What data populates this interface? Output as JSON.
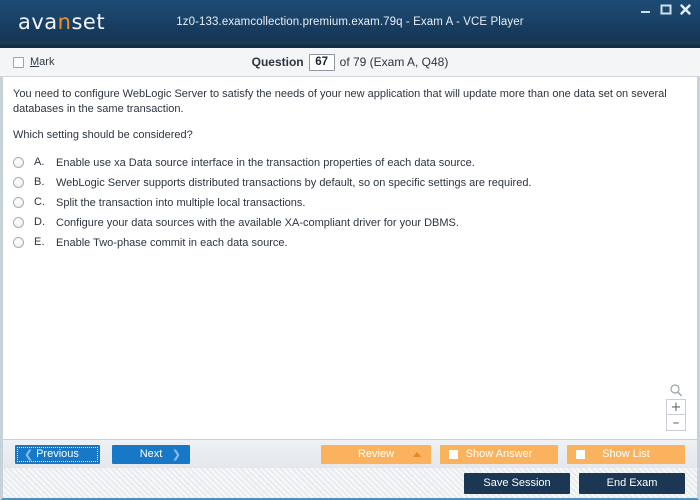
{
  "window": {
    "logo_main": "ava",
    "logo_highlight": "n",
    "logo_tail": "set",
    "title": "1z0-133.examcollection.premium.exam.79q - Exam A - VCE Player",
    "controls": {
      "minimize": "minimize-icon",
      "maximize": "maximize-icon",
      "close": "close-icon"
    },
    "accent_navy": "#1b4469",
    "accent_orange": "#f0922b",
    "accent_blue": "#1878c8"
  },
  "question_header": {
    "mark_label": "Mark",
    "mark_accesskey": "M",
    "mark_checked": false,
    "question_label": "Question",
    "question_number": "67",
    "rest": "of 79 (Exam A, Q48)"
  },
  "question": {
    "paragraph_1": "You need to configure WebLogic Server to satisfy the needs of your new application that will update more than one data set on several databases in the same transaction.",
    "paragraph_2": "Which setting should be considered?",
    "options": [
      {
        "letter": "A.",
        "text": "Enable use xa Data source interface in the transaction properties of each data source.",
        "selected": false
      },
      {
        "letter": "B.",
        "text": "WebLogic Server supports distributed transactions by default, so on specific settings are required.",
        "selected": false
      },
      {
        "letter": "C.",
        "text": "Split the transaction into multiple local transactions.",
        "selected": false
      },
      {
        "letter": "D.",
        "text": "Configure your data sources with the available XA-compliant driver for your DBMS.",
        "selected": false
      },
      {
        "letter": "E.",
        "text": "Enable Two-phase commit in each data source.",
        "selected": false
      }
    ]
  },
  "zoom_controls": {
    "magnifier": "search-icon",
    "zoom_in": "+",
    "zoom_out": "–"
  },
  "navbar": {
    "previous": "Previous",
    "next": "Next",
    "review": "Review",
    "show_answer": "Show Answer",
    "show_list": "Show List"
  },
  "footer": {
    "save_session": "Save Session",
    "end_exam": "End Exam"
  }
}
